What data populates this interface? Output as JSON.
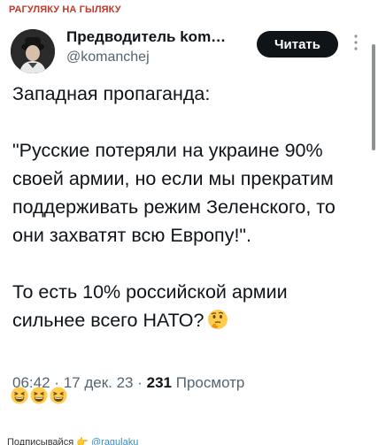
{
  "channel": {
    "name": "РАГУЛЯКУ НА ГЫЛЯКУ"
  },
  "tweet": {
    "author_name": "Предводитель kom…",
    "author_handle": "@komanchej",
    "read_button_label": "Читать",
    "lines": [
      "Западная пропаганда:",
      "\"Русские потеряли на украине 90% своей армии, но если мы прекратим поддерживать режим Зеленского, то они захватят всю Европу!\".",
      "То есть 10% российской армии сильнее всего НАТО?"
    ],
    "emoji_icon": "thinking-face-icon",
    "time": "06:42",
    "separator": "·",
    "date": "17 дек. 23",
    "views_count": "231",
    "views_label": "Просмотр"
  },
  "reactions": [
    {
      "icon": "grinning-squinting-face-icon"
    },
    {
      "icon": "grinning-squinting-face-icon"
    },
    {
      "icon": "grinning-squinting-face-icon"
    }
  ],
  "footer": {
    "label": "Подписывайся",
    "link": "@ragulaku"
  },
  "colors": {
    "channel_name": "#c0392b",
    "button_bg": "#0f1419",
    "text": "#0f1419",
    "muted": "#536471"
  }
}
